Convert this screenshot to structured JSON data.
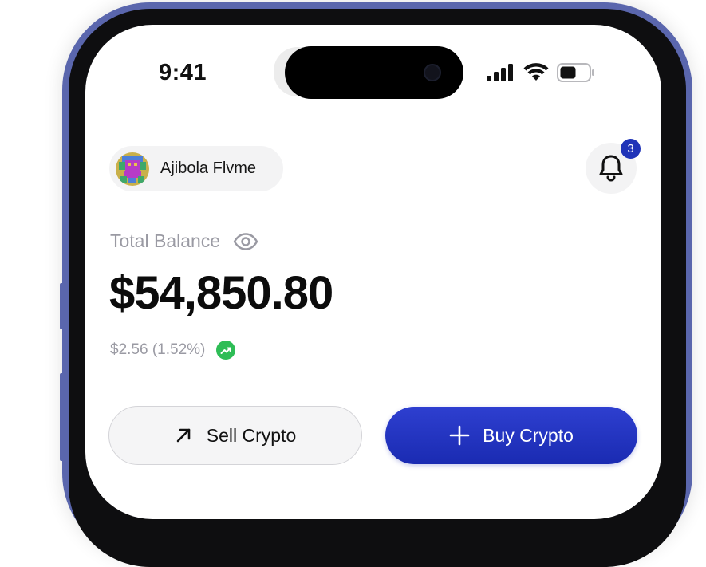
{
  "status_bar": {
    "time": "9:41",
    "icons": [
      "cellular-signal-icon",
      "wifi-icon",
      "battery-icon"
    ]
  },
  "profile": {
    "name": "Ajibola Flvme",
    "avatar_icon": "pixel-art-avatar"
  },
  "notifications": {
    "icon": "bell-icon",
    "badge_count": "3"
  },
  "balance": {
    "label": "Total Balance",
    "visibility_icon": "eye-icon",
    "amount": "$54,850.80",
    "change": "$2.56 (1.52%)",
    "trend_icon": "trending-up-icon"
  },
  "actions": {
    "sell_label": "Sell Crypto",
    "sell_icon": "arrow-up-right-icon",
    "buy_label": "Buy Crypto",
    "buy_icon": "plus-icon"
  },
  "colors": {
    "phone_frame": "#5a66ad",
    "primary": "#1f33b8",
    "positive": "#2ebd56",
    "muted_text": "#9a9aa3"
  }
}
